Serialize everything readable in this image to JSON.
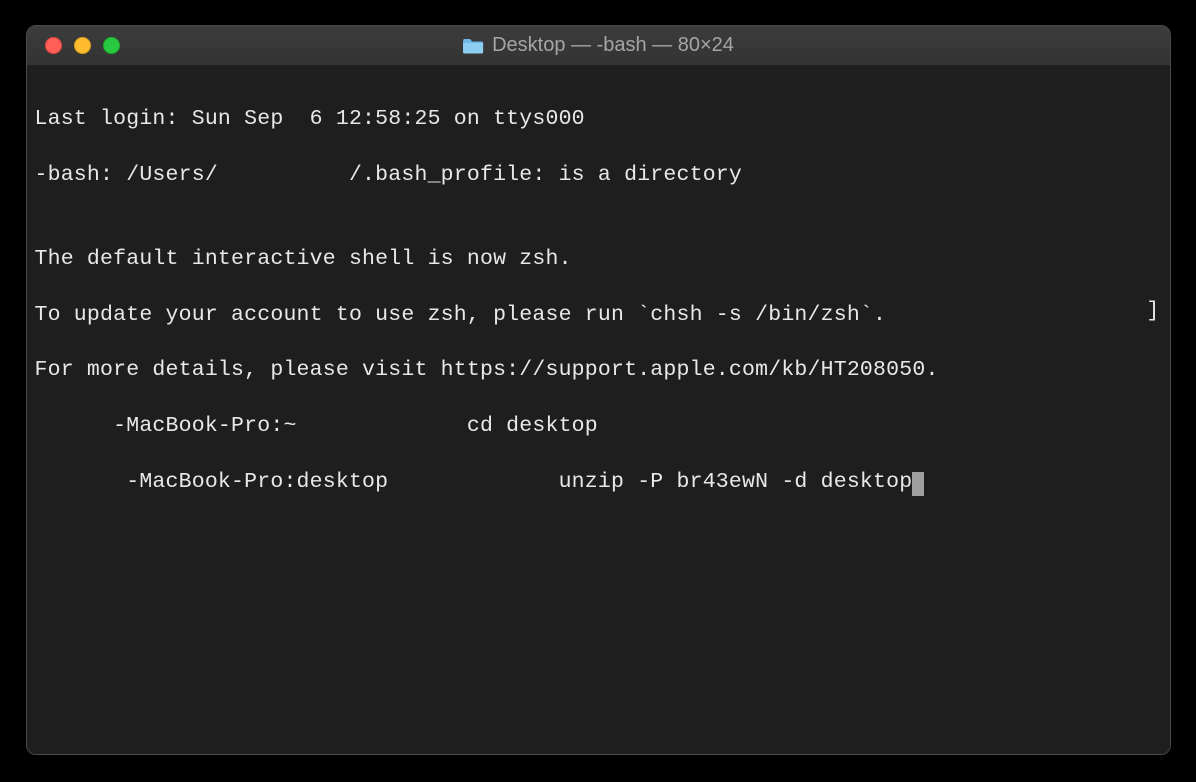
{
  "titlebar": {
    "title": "Desktop — -bash — 80×24"
  },
  "terminal": {
    "lines": [
      "Last login: Sun Sep  6 12:58:25 on ttys000",
      "-bash: /Users/          /.bash_profile: is a directory",
      "",
      "The default interactive shell is now zsh.",
      "To update your account to use zsh, please run `chsh -s /bin/zsh`.",
      "For more details, please visit https://support.apple.com/kb/HT208050.",
      "      -MacBook-Pro:~             cd desktop",
      "       -MacBook-Pro:desktop             unzip -P br43ewN -d desktop"
    ],
    "right_edge_char": "]"
  }
}
